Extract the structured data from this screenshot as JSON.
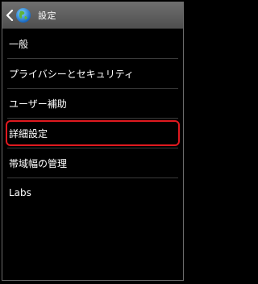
{
  "header": {
    "title": "設定"
  },
  "menu": {
    "items": [
      {
        "label": "一般"
      },
      {
        "label": "プライバシーとセキュリティ"
      },
      {
        "label": "ユーザー補助"
      },
      {
        "label": "詳細設定",
        "highlighted": true
      },
      {
        "label": "帯域幅の管理"
      },
      {
        "label": "Labs"
      }
    ]
  },
  "colors": {
    "highlight": "#e0191f",
    "actionbar": "#5f5f5f",
    "background": "#000000"
  }
}
